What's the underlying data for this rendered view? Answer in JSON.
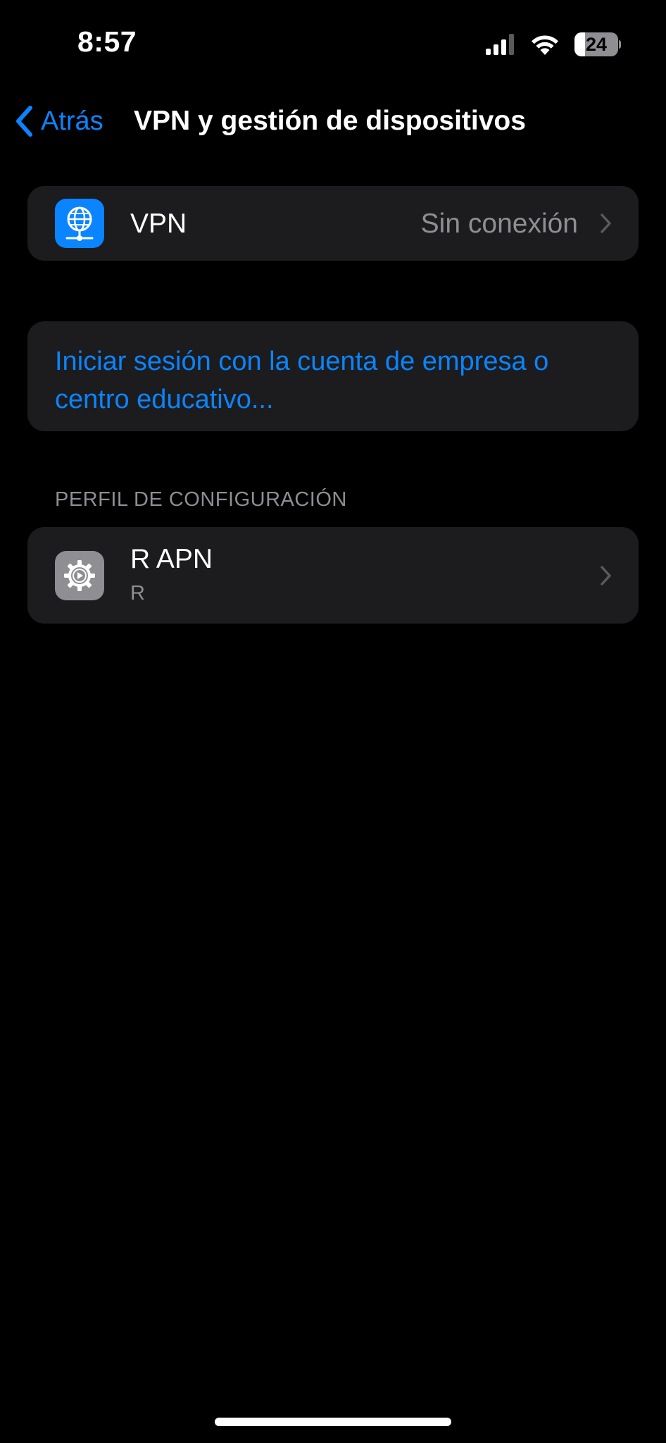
{
  "status_bar": {
    "time": "8:57",
    "battery_level": "24",
    "battery_fraction": 0.24,
    "cellular_icon": "cellular-signal-icon",
    "wifi_icon": "wifi-icon"
  },
  "nav": {
    "back_label": "Atrás",
    "title": "VPN y gestión de dispositivos"
  },
  "vpn_row": {
    "label": "VPN",
    "value": "Sin conexión",
    "icon": "globe-network-icon",
    "icon_color": "#0a84ff"
  },
  "signin": {
    "line1": "Iniciar sesión con la cuenta de empresa o",
    "line2": "centro educativo..."
  },
  "profiles_section": {
    "header": "PERFIL DE CONFIGURACIÓN",
    "items": [
      {
        "title": "R APN",
        "subtitle": "R",
        "icon": "settings-gear-icon",
        "icon_color": "#8e8e93"
      }
    ]
  },
  "colors": {
    "background": "#000000",
    "group_background": "#1c1c1e",
    "accent": "#0a84ff",
    "secondary_text": "#8e8e93"
  }
}
